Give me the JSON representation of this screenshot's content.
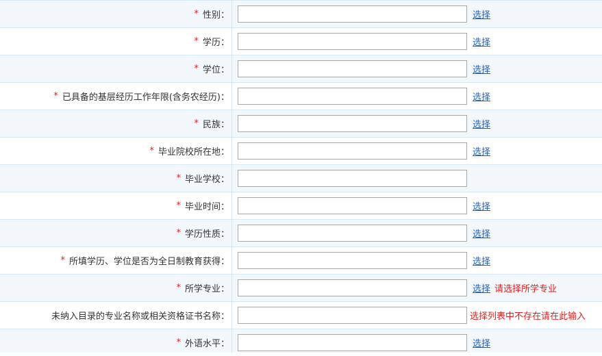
{
  "required_mark": "*",
  "select_label": "选择",
  "fields": [
    {
      "label": "性别：",
      "value": ""
    },
    {
      "label": "学历：",
      "value": ""
    },
    {
      "label": "学位：",
      "value": ""
    },
    {
      "label": "已具备的基层经历工作年限(含务农经历)：",
      "value": ""
    },
    {
      "label": "民族：",
      "value": ""
    },
    {
      "label": "毕业院校所在地：",
      "value": ""
    },
    {
      "label": "毕业学校：",
      "value": ""
    },
    {
      "label": "毕业时间：",
      "value": ""
    },
    {
      "label": "学历性质：",
      "value": ""
    },
    {
      "label": "所填学历、学位是否为全日制教育获得：",
      "value": ""
    },
    {
      "label": "所学专业：",
      "value": "",
      "hint": "请选择所学专业"
    },
    {
      "label": "未纳入目录的专业名称或相关资格证书名称：",
      "value": "",
      "hint": "选择列表中不存在请在此输入"
    },
    {
      "label": "外语水平：",
      "value": ""
    }
  ]
}
